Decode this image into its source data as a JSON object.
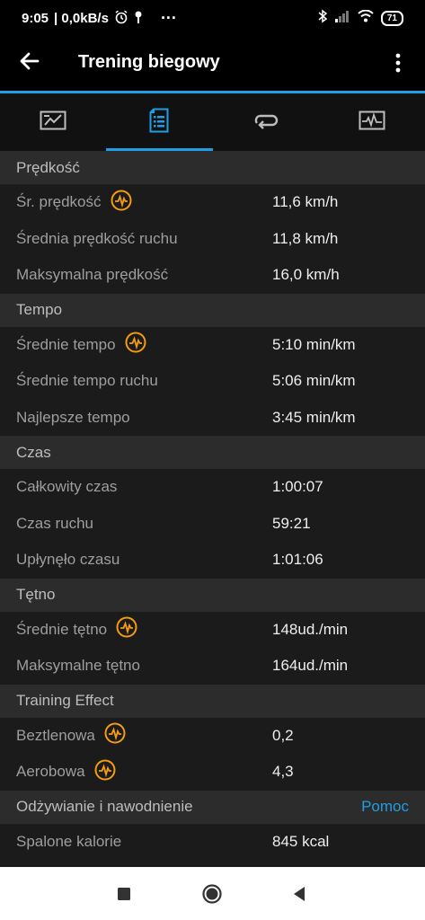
{
  "status": {
    "time": "9:05",
    "speed": "| 0,0kB/s",
    "dots": "···",
    "battery": "71"
  },
  "app_bar": {
    "title": "Trening biegowy"
  },
  "tabs": [
    {
      "name": "summary-chart"
    },
    {
      "name": "details-list"
    },
    {
      "name": "laps"
    },
    {
      "name": "graphs"
    }
  ],
  "sections": {
    "speed": {
      "header": "Prędkość",
      "rows": [
        {
          "label": "Śr. prędkość",
          "value": "11,6 km/h",
          "has_icon": true
        },
        {
          "label": "Średnia prędkość ruchu",
          "value": "11,8 km/h"
        },
        {
          "label": "Maksymalna prędkość",
          "value": "16,0 km/h"
        }
      ]
    },
    "pace": {
      "header": "Tempo",
      "rows": [
        {
          "label": "Średnie tempo",
          "value": "5:10 min/km",
          "has_icon": true
        },
        {
          "label": "Średnie tempo ruchu",
          "value": "5:06 min/km"
        },
        {
          "label": "Najlepsze tempo",
          "value": "3:45 min/km"
        }
      ]
    },
    "time": {
      "header": "Czas",
      "rows": [
        {
          "label": "Całkowity czas",
          "value": "1:00:07"
        },
        {
          "label": "Czas ruchu",
          "value": "59:21"
        },
        {
          "label": "Upłynęło czasu",
          "value": "1:01:06"
        }
      ]
    },
    "heart": {
      "header": "Tętno",
      "rows": [
        {
          "label": "Średnie tętno",
          "value": "148ud./min",
          "has_icon": true
        },
        {
          "label": "Maksymalne tętno",
          "value": "164ud./min"
        }
      ]
    },
    "training": {
      "header": "Training Effect",
      "rows": [
        {
          "label": "Beztlenowa",
          "value": "0,2",
          "has_icon": true
        },
        {
          "label": "Aerobowa",
          "value": "4,3",
          "has_icon": true
        }
      ]
    },
    "nutrition": {
      "header": "Odżywianie i nawodnienie",
      "help": "Pomoc",
      "rows": [
        {
          "label": "Spalone kalorie",
          "value": "845 kcal"
        }
      ]
    }
  },
  "colors": {
    "accent": "#1f9ee4",
    "icon_orange": "#f39c12"
  }
}
